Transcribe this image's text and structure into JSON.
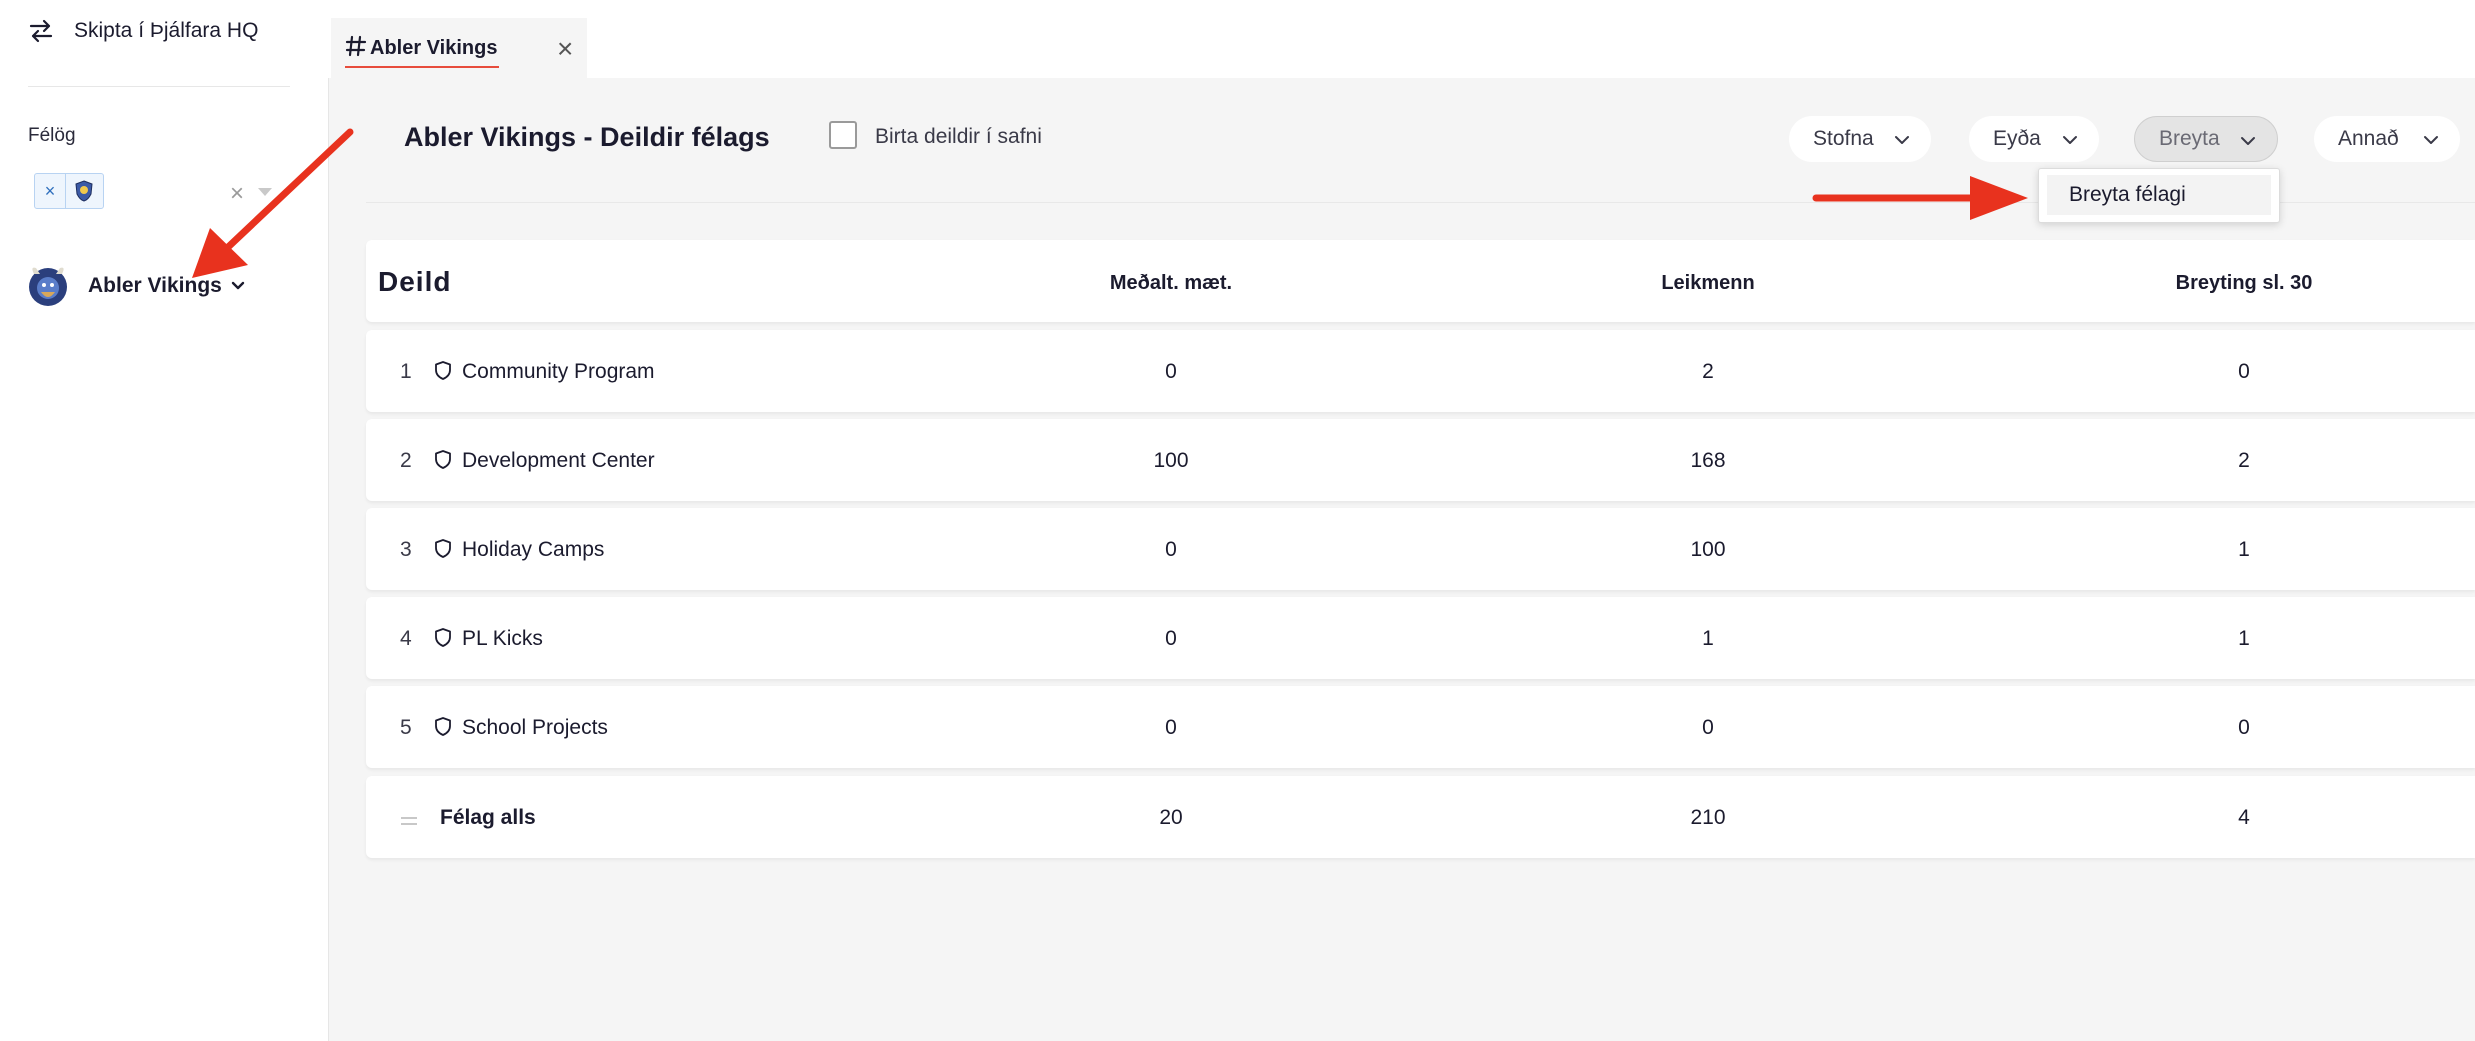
{
  "sidebar": {
    "switch_label": "Skipta í Þjálfara HQ",
    "felog_label": "Félög",
    "chip_remove": "×",
    "clear": "×",
    "club_name": "Abler Vikings"
  },
  "tab": {
    "title": "Abler Vikings",
    "close": "×"
  },
  "page": {
    "title": "Abler Vikings - Deildir félags",
    "archive_label": "Birta deildir í safni"
  },
  "actions": [
    {
      "label": "Stofna"
    },
    {
      "label": "Eyða"
    },
    {
      "label": "Breyta"
    },
    {
      "label": "Annað"
    }
  ],
  "dropdown": {
    "item": "Breyta félagi"
  },
  "table": {
    "headers": {
      "deild": "Deild",
      "avg": "Meðalt. mæt.",
      "players": "Leikmenn",
      "change": "Breyting sl. 30"
    },
    "rows": [
      {
        "num": "1",
        "name": "Community Program",
        "avg": "0",
        "players": "2",
        "change": "0"
      },
      {
        "num": "2",
        "name": "Development Center",
        "avg": "100",
        "players": "168",
        "change": "2"
      },
      {
        "num": "3",
        "name": "Holiday Camps",
        "avg": "0",
        "players": "100",
        "change": "1"
      },
      {
        "num": "4",
        "name": "PL Kicks",
        "avg": "0",
        "players": "1",
        "change": "1"
      },
      {
        "num": "5",
        "name": "School Projects",
        "avg": "0",
        "players": "0",
        "change": "0"
      }
    ],
    "total": {
      "name": "Félag alls",
      "avg": "20",
      "players": "210",
      "change": "4"
    }
  },
  "icons": {
    "switch": "switch-arrows-icon",
    "hash": "hash-icon",
    "shield": "shield-icon",
    "chevron": "chevron-down-icon",
    "equals": "equals-icon"
  },
  "colors": {
    "accent_red": "#e74c3c",
    "annotation_arrow": "#e8321e"
  }
}
